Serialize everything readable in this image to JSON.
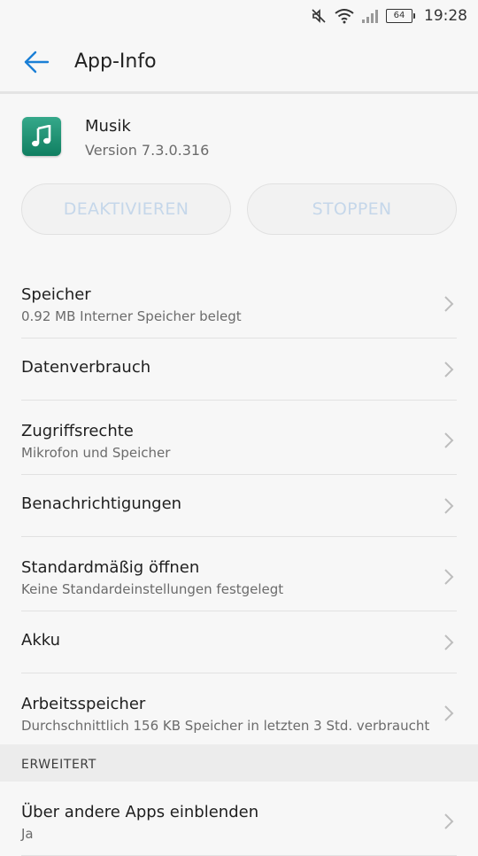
{
  "status_bar": {
    "battery": "64",
    "time": "19:28",
    "icons": [
      "mute-icon",
      "wifi-icon",
      "signal-icon",
      "battery-icon"
    ]
  },
  "app_bar": {
    "title": "App-Info",
    "back_icon": "back-arrow-icon"
  },
  "app": {
    "name": "Musik",
    "version": "Version 7.3.0.316",
    "icon": "music-note-icon"
  },
  "actions": {
    "disable_label": "DEAKTIVIEREN",
    "stop_label": "STOPPEN"
  },
  "items": [
    {
      "title": "Speicher",
      "subtitle": "0.92 MB Interner Speicher belegt"
    },
    {
      "title": "Datenverbrauch",
      "subtitle": ""
    },
    {
      "title": "Zugriffsrechte",
      "subtitle": "Mikrofon und Speicher"
    },
    {
      "title": "Benachrichtigungen",
      "subtitle": ""
    },
    {
      "title": "Standardmäßig öffnen",
      "subtitle": "Keine Standardeinstellungen festgelegt"
    },
    {
      "title": "Akku",
      "subtitle": ""
    },
    {
      "title": "Arbeitsspeicher",
      "subtitle": "Durchschnittlich 156 KB Speicher in letzten 3 Std. verbraucht"
    }
  ],
  "advanced": {
    "header": "ERWEITERT",
    "items": [
      {
        "title": "Über andere Apps einblenden",
        "subtitle": "Ja"
      }
    ]
  },
  "colors": {
    "accent": "#1a7fd6",
    "disabled_text": "#c5d7ea",
    "icon_green": "#107f61"
  }
}
